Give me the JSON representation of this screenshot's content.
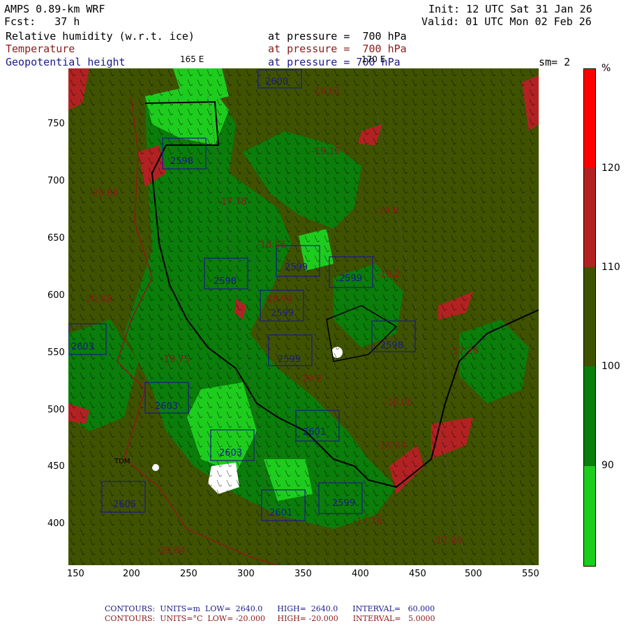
{
  "header": {
    "model": "AMPS 0.89-km WRF",
    "init": "Init: 12 UTC Sat 31 Jan 26",
    "fcst": "Fcst:   37 h",
    "valid": "Valid: 01 UTC Mon 02 Feb 26",
    "field1_name": "Relative humidity (w.r.t. ice)",
    "field1_level": "at pressure =  700 hPa",
    "field2_name": "Temperature",
    "field2_level": "at pressure =  700 hPa",
    "field3_name": "Geopotential height",
    "field3_level": "at pressure = 700 hPa",
    "lon_label_165": "165 E",
    "lon_label_170": "170 E",
    "smoothing": "sm= 2"
  },
  "axes": {
    "y_ticks": [
      "750",
      "700",
      "650",
      "600",
      "550",
      "500",
      "450",
      "400"
    ],
    "x_ticks": [
      "150",
      "200",
      "250",
      "300",
      "350",
      "400",
      "450",
      "500",
      "550"
    ]
  },
  "legend": {
    "unit": "%",
    "labels": [
      "120",
      "110",
      "100",
      "90"
    ],
    "colors": [
      "#ff0000",
      "#b22222",
      "#3f5200",
      "#0a7d0a",
      "#1ecc1e"
    ]
  },
  "map_labels": {
    "heights": [
      "2600",
      "2598",
      "2599",
      "2598",
      "2599",
      "2599",
      "2598",
      "2599",
      "2603",
      "2603",
      "2603",
      "2601",
      "2605",
      "2601",
      "2599"
    ],
    "temps": [
      "-19.61",
      "-19.15",
      "-20.68",
      "-17.78",
      "-19.8",
      "-18.56",
      "-19.2",
      "-20.48",
      "-18.94",
      "-19.75",
      "-17.29",
      "-19.2",
      "-18.05",
      "-18.04",
      "-17.78",
      "-17.94",
      "-20.64"
    ],
    "station": "TDM"
  },
  "footer": {
    "line1": "CONTOURS:  UNITS=m  LOW=  2640.0      HIGH=  2640.0      INTERVAL=   60.000",
    "line2": "CONTOURS:  UNITS=°C  LOW= -20.000     HIGH= -20.000      INTERVAL=   5.0000"
  }
}
